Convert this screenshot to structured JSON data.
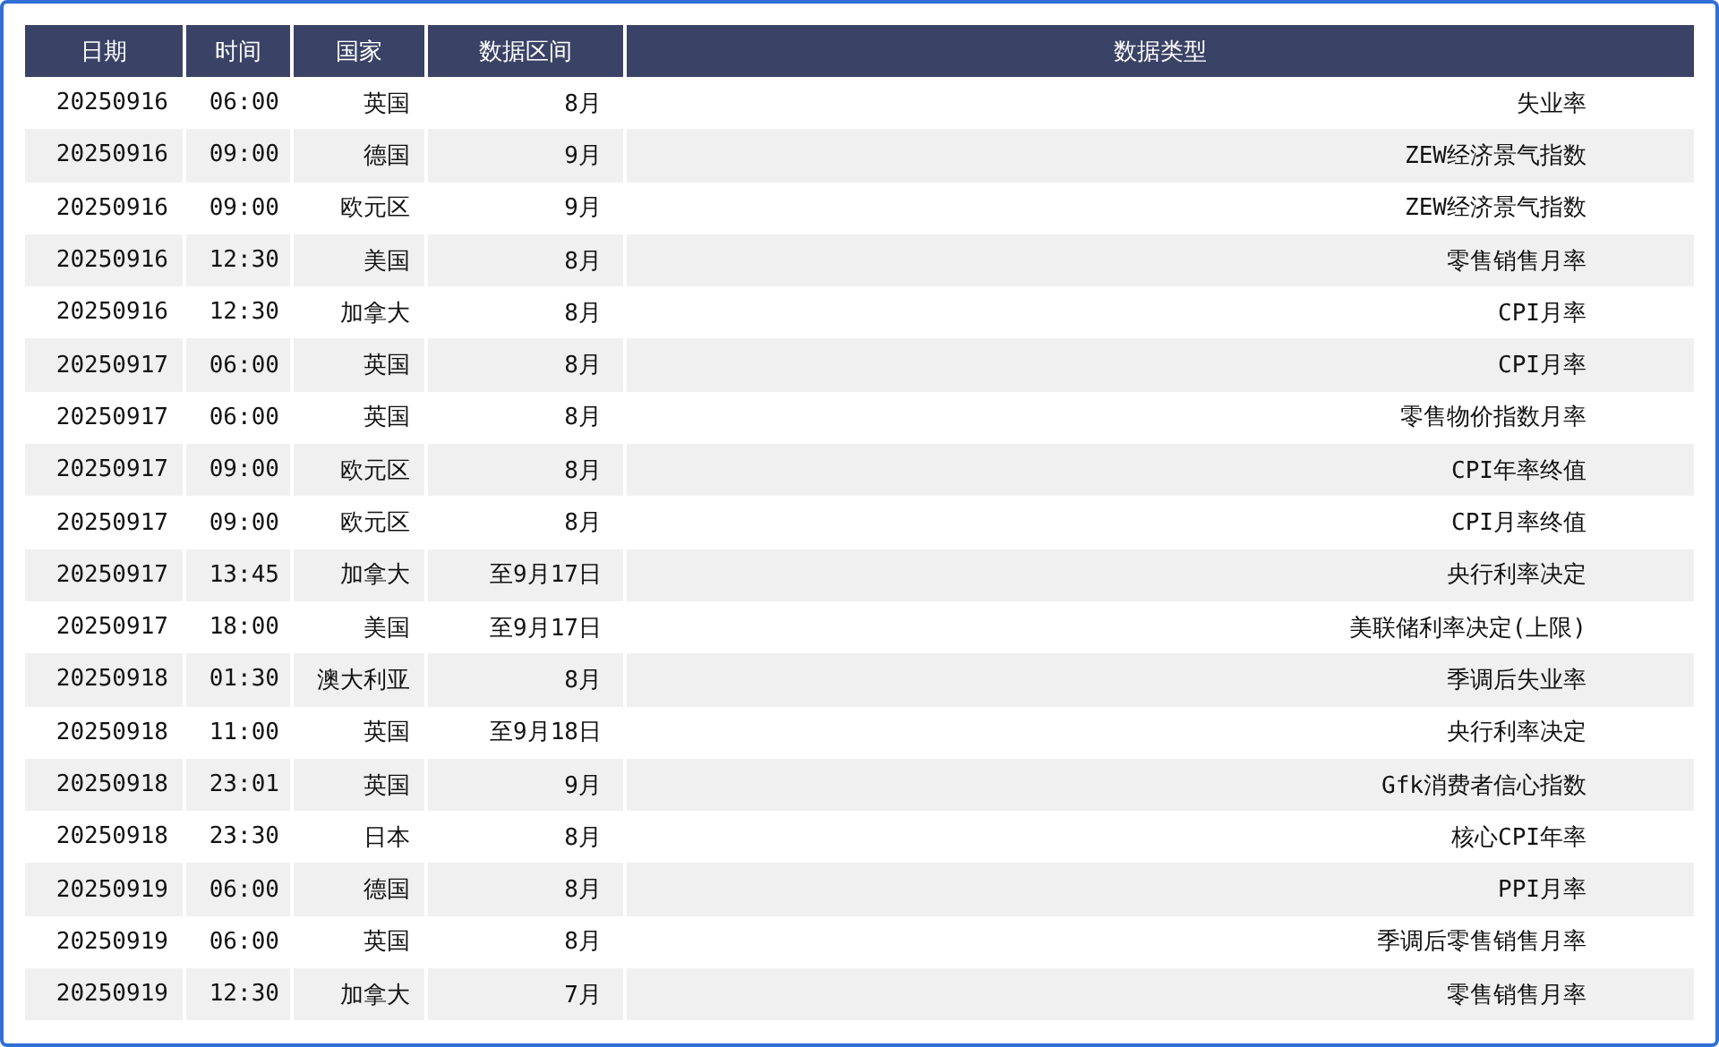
{
  "table": {
    "columns": [
      "日期",
      "时间",
      "国家",
      "数据区间",
      "数据类型"
    ],
    "rows": [
      [
        "20250916",
        "06:00",
        "英国",
        "8月",
        "失业率"
      ],
      [
        "20250916",
        "09:00",
        "德国",
        "9月",
        "ZEW经济景气指数"
      ],
      [
        "20250916",
        "09:00",
        "欧元区",
        "9月",
        "ZEW经济景气指数"
      ],
      [
        "20250916",
        "12:30",
        "美国",
        "8月",
        "零售销售月率"
      ],
      [
        "20250916",
        "12:30",
        "加拿大",
        "8月",
        "CPI月率"
      ],
      [
        "20250917",
        "06:00",
        "英国",
        "8月",
        "CPI月率"
      ],
      [
        "20250917",
        "06:00",
        "英国",
        "8月",
        "零售物价指数月率"
      ],
      [
        "20250917",
        "09:00",
        "欧元区",
        "8月",
        "CPI年率终值"
      ],
      [
        "20250917",
        "09:00",
        "欧元区",
        "8月",
        "CPI月率终值"
      ],
      [
        "20250917",
        "13:45",
        "加拿大",
        "至9月17日",
        "央行利率决定"
      ],
      [
        "20250917",
        "18:00",
        "美国",
        "至9月17日",
        "美联储利率决定(上限)"
      ],
      [
        "20250918",
        "01:30",
        "澳大利亚",
        "8月",
        "季调后失业率"
      ],
      [
        "20250918",
        "11:00",
        "英国",
        "至9月18日",
        "央行利率决定"
      ],
      [
        "20250918",
        "23:01",
        "英国",
        "9月",
        "Gfk消费者信心指数"
      ],
      [
        "20250918",
        "23:30",
        "日本",
        "8月",
        "核心CPI年率"
      ],
      [
        "20250919",
        "06:00",
        "德国",
        "8月",
        "PPI月率"
      ],
      [
        "20250919",
        "06:00",
        "英国",
        "8月",
        "季调后零售销售月率"
      ],
      [
        "20250919",
        "12:30",
        "加拿大",
        "7月",
        "零售销售月率"
      ]
    ]
  }
}
